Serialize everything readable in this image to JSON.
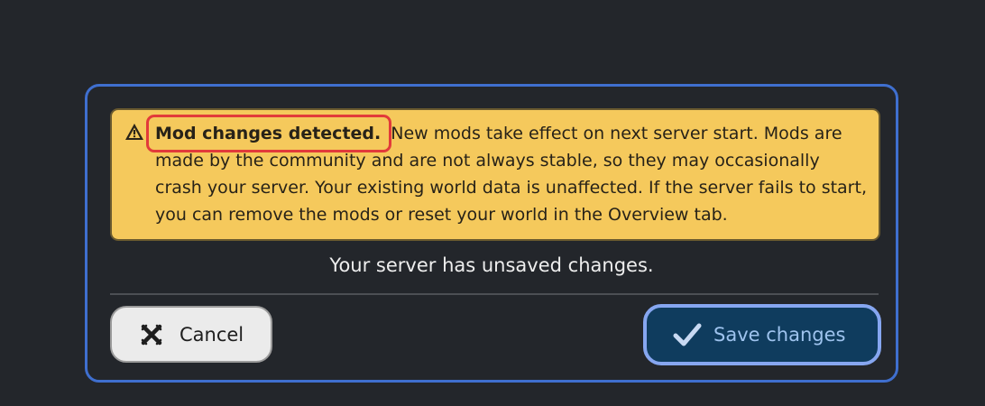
{
  "dialog": {
    "warning": {
      "icon": "warning-triangle-icon",
      "title": "Mod changes detected.",
      "body": " New mods take effect on next server start. Mods are made by the community and are not always stable, so they may occasionally crash your server. Your existing world data is unaffected. If the server fails to start, you can remove the mods or reset your world in the Overview tab."
    },
    "status_text": "Your server has unsaved changes.",
    "cancel_button": {
      "label": "Cancel",
      "icon": "close-x-icon"
    },
    "save_button": {
      "label": "Save changes",
      "icon": "checkmark-icon"
    }
  },
  "colors": {
    "background": "#23262b",
    "dialog_border": "#3f6fcf",
    "warning_bg": "#f5c95c",
    "highlight": "#e23a3a",
    "save_bg": "#0f3c5e",
    "save_border": "#86a6f0",
    "save_text": "#9ec3ee",
    "cancel_bg": "#ebebeb"
  }
}
